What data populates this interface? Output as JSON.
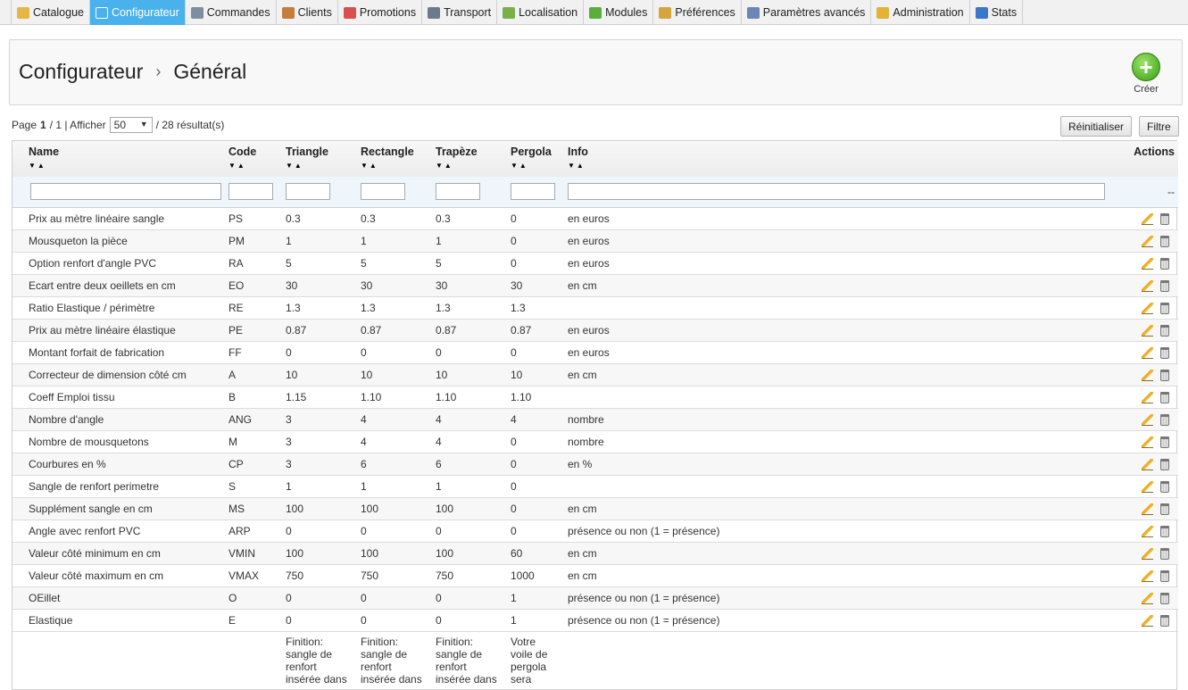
{
  "nav": {
    "tabs": [
      {
        "label": "Catalogue",
        "icon": "folder-icon",
        "color": "#e6b547"
      },
      {
        "label": "Configurateur",
        "icon": "configurator-icon",
        "color": "#49b2ec",
        "active": true
      },
      {
        "label": "Commandes",
        "icon": "cart-icon",
        "color": "#7d8ea0"
      },
      {
        "label": "Clients",
        "icon": "user-icon",
        "color": "#c47d3b"
      },
      {
        "label": "Promotions",
        "icon": "promotion-icon",
        "color": "#d94f4f"
      },
      {
        "label": "Transport",
        "icon": "truck-icon",
        "color": "#6c7b8b"
      },
      {
        "label": "Localisation",
        "icon": "globe-icon",
        "color": "#79b04a"
      },
      {
        "label": "Modules",
        "icon": "puzzle-icon",
        "color": "#5cae3c"
      },
      {
        "label": "Préférences",
        "icon": "preferences-icon",
        "color": "#d6a33c"
      },
      {
        "label": "Paramètres avancés",
        "icon": "wrench-icon",
        "color": "#6a87b8"
      },
      {
        "label": "Administration",
        "icon": "key-icon",
        "color": "#e2b337"
      },
      {
        "label": "Stats",
        "icon": "bar-chart-icon",
        "color": "#3b78c9"
      }
    ]
  },
  "header": {
    "breadcrumb_parent": "Configurateur",
    "breadcrumb_sep": "›",
    "breadcrumb_current": "Général",
    "create_label": "Créer"
  },
  "pager": {
    "page_prefix": "Page",
    "page_current": "1",
    "page_total": "/ 1 | Afficher",
    "per_page": "50",
    "results": "/ 28 résultat(s)",
    "reset_label": "Réinitialiser",
    "filter_label": "Filtre"
  },
  "table": {
    "columns": [
      "Name",
      "Code",
      "Triangle",
      "Rectangle",
      "Trapèze",
      "Pergola",
      "Info",
      "Actions"
    ],
    "sort_arrows": "▼▲",
    "filter_placeholder_actions": "--",
    "rows": [
      [
        "Prix au mètre linéaire sangle",
        "PS",
        "0.3",
        "0.3",
        "0.3",
        "0",
        "en euros"
      ],
      [
        "Mousqueton la pièce",
        "PM",
        "1",
        "1",
        "1",
        "0",
        "en euros"
      ],
      [
        "Option renfort d'angle PVC",
        "RA",
        "5",
        "5",
        "5",
        "0",
        "en euros"
      ],
      [
        "Ecart entre deux oeillets en cm",
        "EO",
        "30",
        "30",
        "30",
        "30",
        "en cm"
      ],
      [
        "Ratio Elastique / périmètre",
        "RE",
        "1.3",
        "1.3",
        "1.3",
        "1.3",
        ""
      ],
      [
        "Prix au mètre linéaire élastique",
        "PE",
        "0.87",
        "0.87",
        "0.87",
        "0.87",
        "en euros"
      ],
      [
        "Montant forfait de fabrication",
        "FF",
        "0",
        "0",
        "0",
        "0",
        "en euros"
      ],
      [
        "Correcteur de dimension côté cm",
        "A",
        "10",
        "10",
        "10",
        "10",
        "en cm"
      ],
      [
        "Coeff Emploi tissu",
        "B",
        "1.15",
        "1.10",
        "1.10",
        "1.10",
        ""
      ],
      [
        "Nombre d'angle",
        "ANG",
        "3",
        "4",
        "4",
        "4",
        "nombre"
      ],
      [
        "Nombre de mousquetons",
        "M",
        "3",
        "4",
        "4",
        "0",
        "nombre"
      ],
      [
        "Courbures en %",
        "CP",
        "3",
        "6",
        "6",
        "0",
        "en %"
      ],
      [
        "Sangle de renfort perimetre",
        "S",
        "1",
        "1",
        "1",
        "0",
        ""
      ],
      [
        "Supplément sangle en cm",
        "MS",
        "100",
        "100",
        "100",
        "0",
        "en cm"
      ],
      [
        "Angle avec renfort PVC",
        "ARP",
        "0",
        "0",
        "0",
        "0",
        "présence ou non (1 = présence)"
      ],
      [
        "Valeur côté minimum en cm",
        "VMIN",
        "100",
        "100",
        "100",
        "60",
        "en cm"
      ],
      [
        "Valeur côté maximum en cm",
        "VMAX",
        "750",
        "750",
        "750",
        "1000",
        "en cm"
      ],
      [
        "OEillet",
        "O",
        "0",
        "0",
        "0",
        "1",
        "présence ou non (1 = présence)"
      ],
      [
        "Elastique",
        "E",
        "0",
        "0",
        "0",
        "1",
        "présence ou non (1 = présence)"
      ]
    ],
    "last_row": [
      "",
      "",
      "Finition: sangle de renfort insérée dans",
      "Finition: sangle de renfort insérée dans",
      "Finition: sangle de renfort insérée dans",
      "Votre voile de pergola sera",
      ""
    ]
  }
}
